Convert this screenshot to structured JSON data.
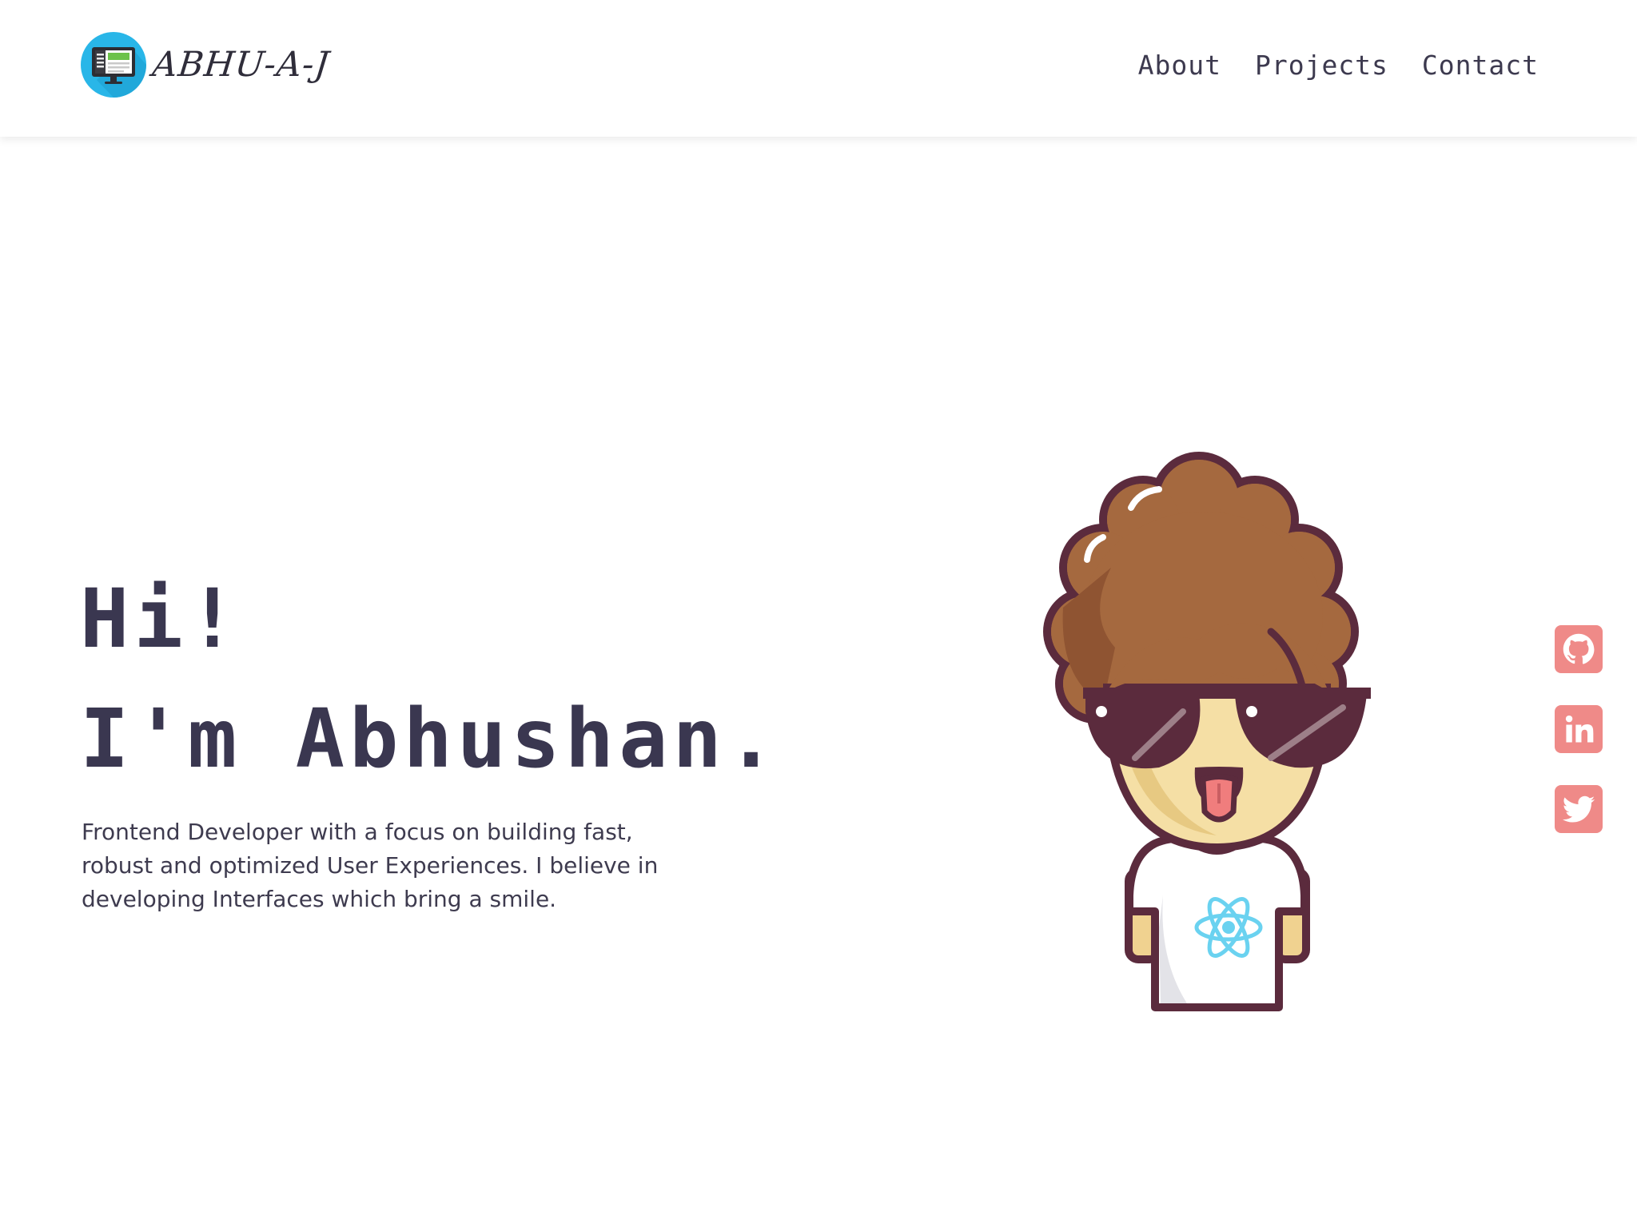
{
  "header": {
    "logo_text": "ABHU-A-J",
    "nav": [
      {
        "label": "About"
      },
      {
        "label": "Projects"
      },
      {
        "label": "Contact"
      }
    ]
  },
  "hero": {
    "greeting_line1": "Hi!",
    "greeting_line2": "I'm Abhushan.",
    "description": "Frontend Developer with a focus on building fast, robust and optimized User Experiences. I believe in developing Interfaces which bring a smile."
  },
  "social": [
    {
      "icon": "github-icon"
    },
    {
      "icon": "linkedin-icon"
    },
    {
      "icon": "twitter-icon"
    }
  ],
  "colors": {
    "text_dark": "#3a3750",
    "accent_social": "#ef8a88",
    "logo_circle": "#29b6e8"
  }
}
